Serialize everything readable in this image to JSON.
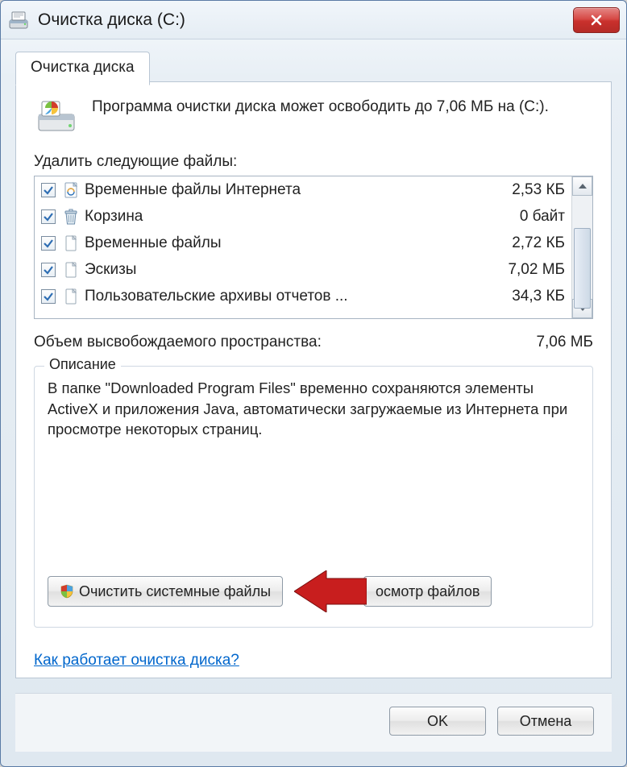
{
  "window": {
    "title": "Очистка диска  (C:)"
  },
  "tab": {
    "label": "Очистка диска"
  },
  "intro": {
    "text": "Программа очистки диска может освободить до 7,06 МБ на  (C:)."
  },
  "files": {
    "label": "Удалить следующие файлы:",
    "items": [
      {
        "checked": true,
        "icon": "ie-file",
        "name": "Временные файлы Интернета",
        "size": "2,53 КБ"
      },
      {
        "checked": true,
        "icon": "recycle-bin",
        "name": "Корзина",
        "size": "0 байт"
      },
      {
        "checked": true,
        "icon": "file",
        "name": "Временные файлы",
        "size": "2,72 КБ"
      },
      {
        "checked": true,
        "icon": "file",
        "name": "Эскизы",
        "size": "7,02 МБ"
      },
      {
        "checked": true,
        "icon": "file",
        "name": "Пользовательские архивы отчетов ...",
        "size": "34,3 КБ"
      }
    ]
  },
  "total": {
    "label": "Объем высвобождаемого пространства:",
    "value": "7,06 МБ"
  },
  "description_group": {
    "legend": "Описание",
    "text": "В папке \"Downloaded Program Files\" временно сохраняются элементы ActiveX и приложения Java, автоматически загружаемые из Интернета при просмотре некоторых страниц."
  },
  "buttons": {
    "clean_system": "Очистить системные файлы",
    "view_files": "осмотр файлов"
  },
  "link": {
    "how_works": "Как работает очистка диска?"
  },
  "footer": {
    "ok": "OK",
    "cancel": "Отмена"
  }
}
